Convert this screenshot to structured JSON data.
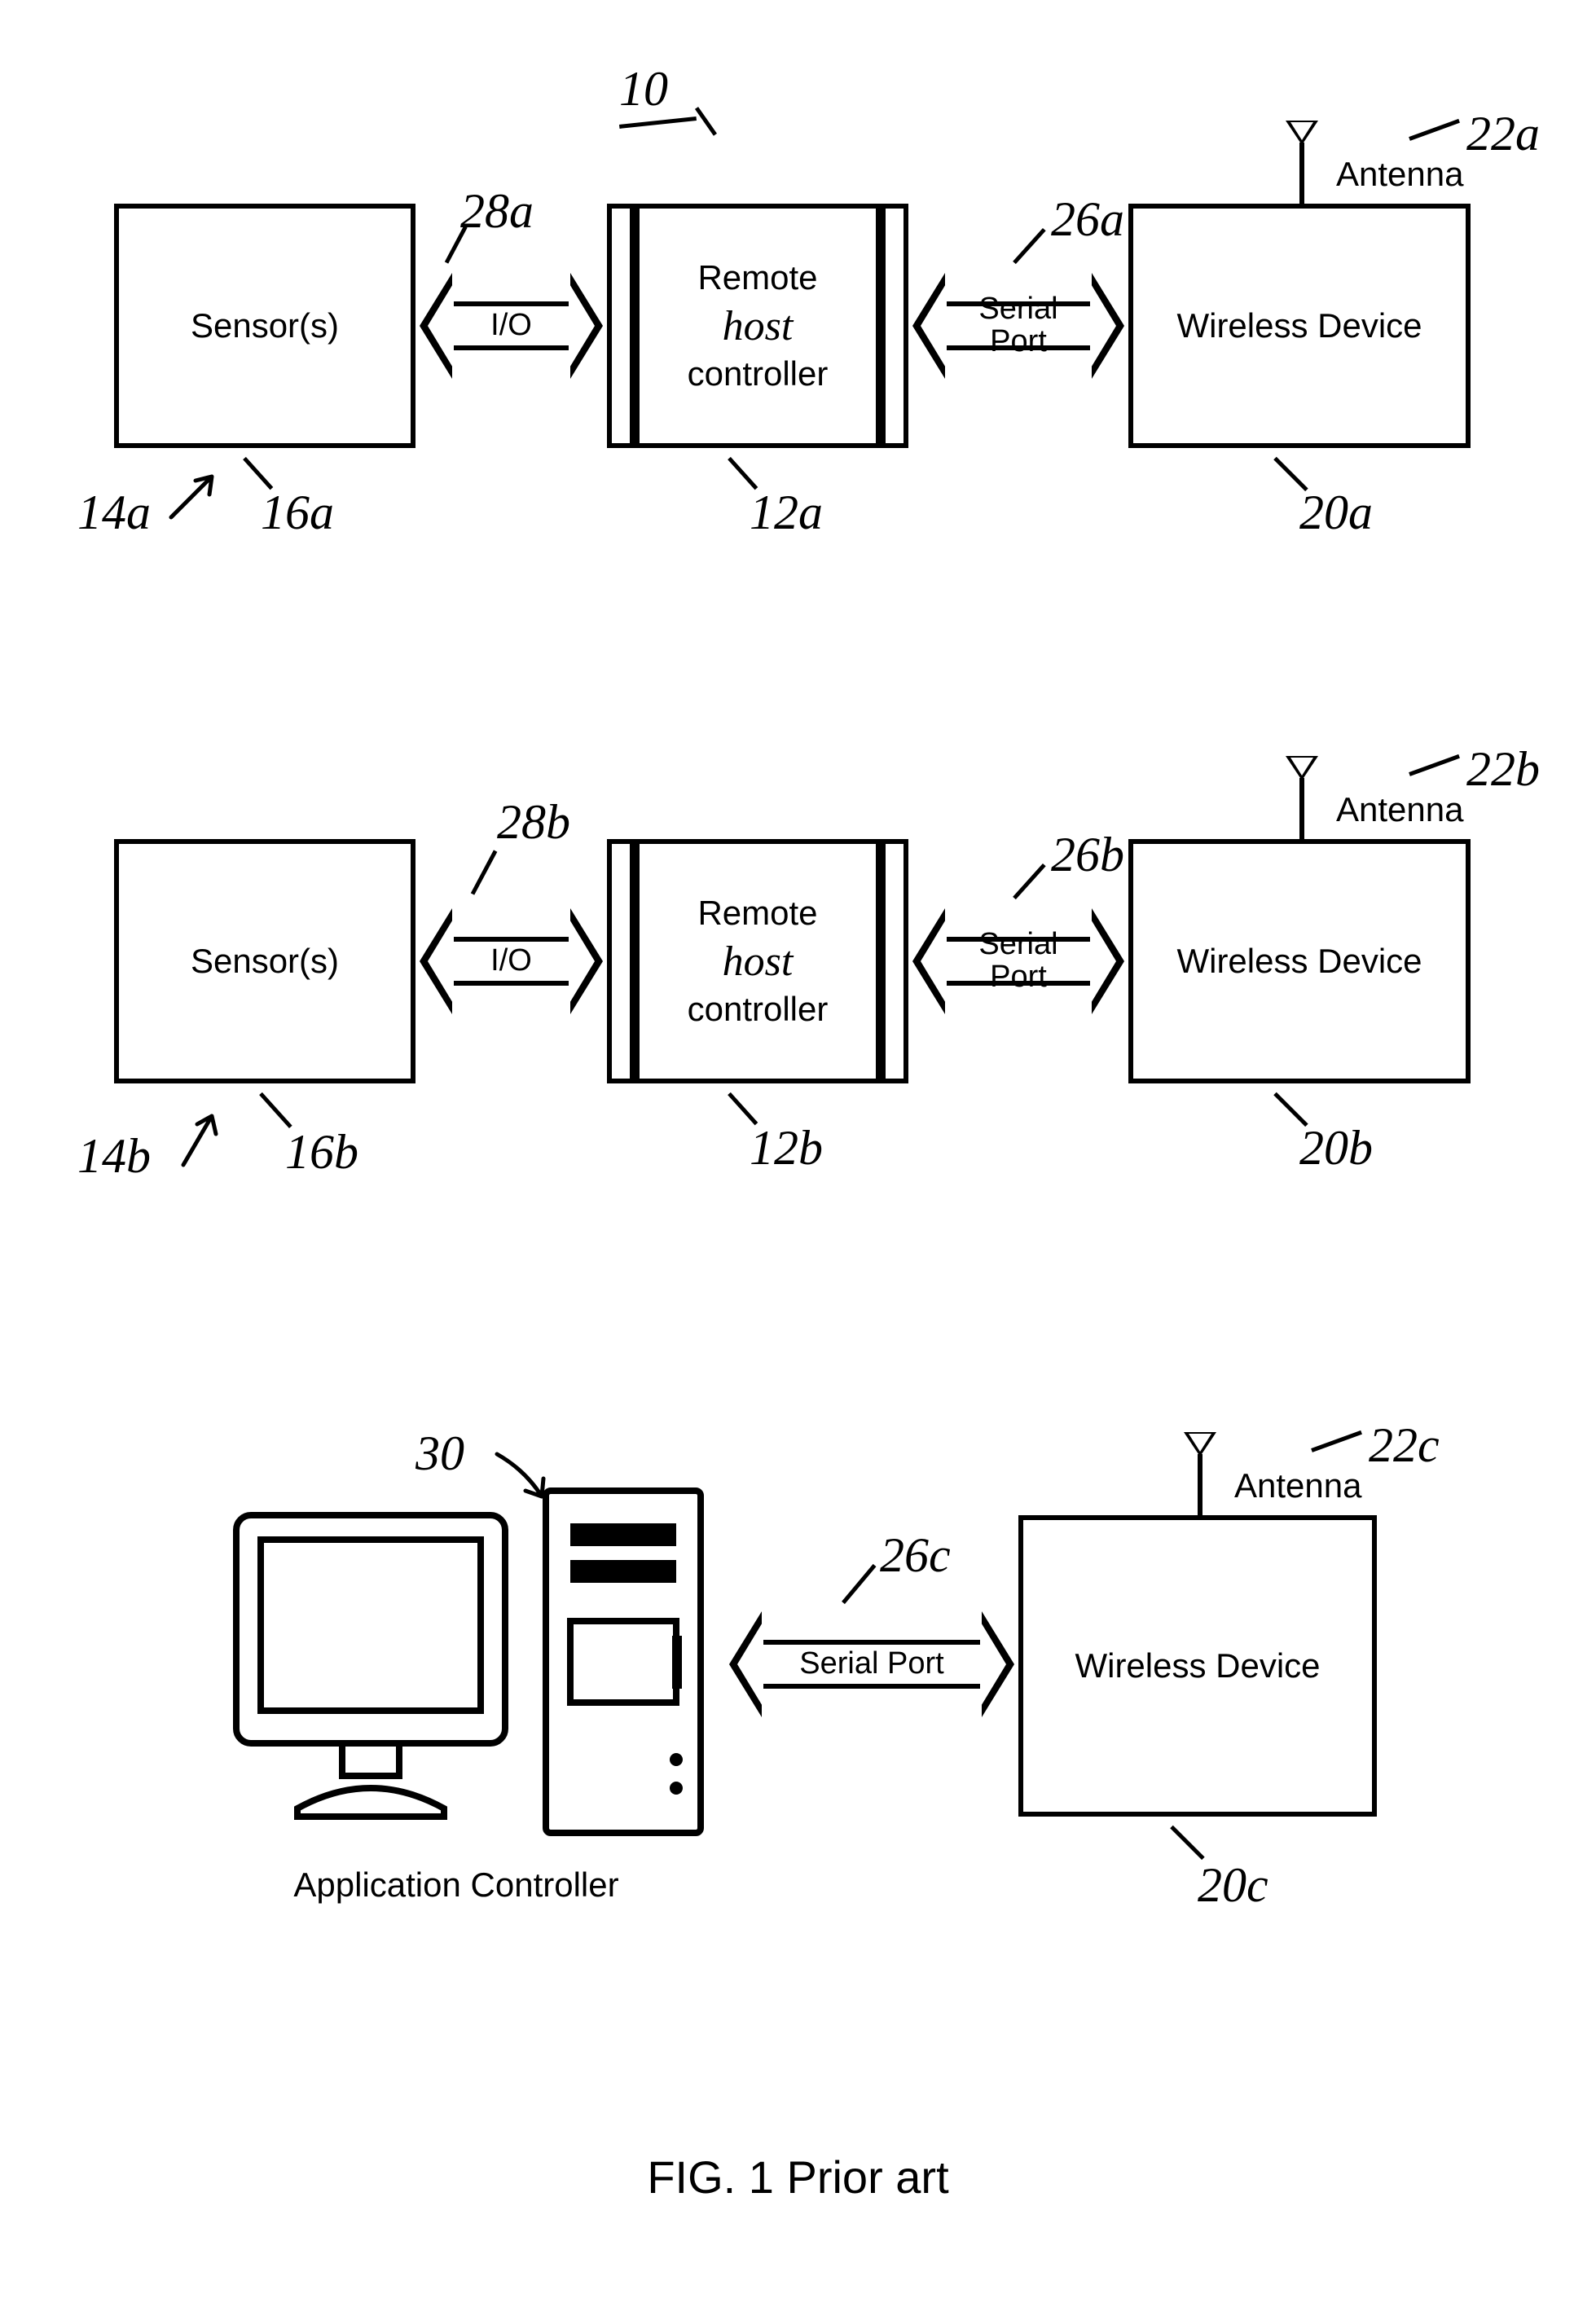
{
  "figure_ref_top": "10",
  "caption": "FIG. 1  Prior art",
  "rows": [
    {
      "sensor_label": "Sensor(s)",
      "io_label": "I/O",
      "controller_line1": "Remote",
      "controller_line2_hw": "host",
      "controller_line3": "controller",
      "serial_label": "Serial\nPort",
      "wireless_label": "Wireless Device",
      "antenna_label": "Antenna",
      "refs": {
        "row_pointer": "14a",
        "sensor": "16a",
        "io": "28a",
        "controller": "12a",
        "serial": "26a",
        "wireless": "20a",
        "antenna": "22a"
      }
    },
    {
      "sensor_label": "Sensor(s)",
      "io_label": "I/O",
      "controller_line1": "Remote",
      "controller_line2_hw": "host",
      "controller_line3": "controller",
      "serial_label": "Serial\nPort",
      "wireless_label": "Wireless Device",
      "antenna_label": "Antenna",
      "refs": {
        "row_pointer": "14b",
        "sensor": "16b",
        "io": "28b",
        "controller": "12b",
        "serial": "26b",
        "wireless": "20b",
        "antenna": "22b"
      }
    }
  ],
  "bottom": {
    "app_controller_label": "Application Controller",
    "serial_label": "Serial Port",
    "wireless_label": "Wireless Device",
    "antenna_label": "Antenna",
    "refs": {
      "app_controller": "30",
      "serial": "26c",
      "wireless": "20c",
      "antenna": "22c"
    }
  }
}
